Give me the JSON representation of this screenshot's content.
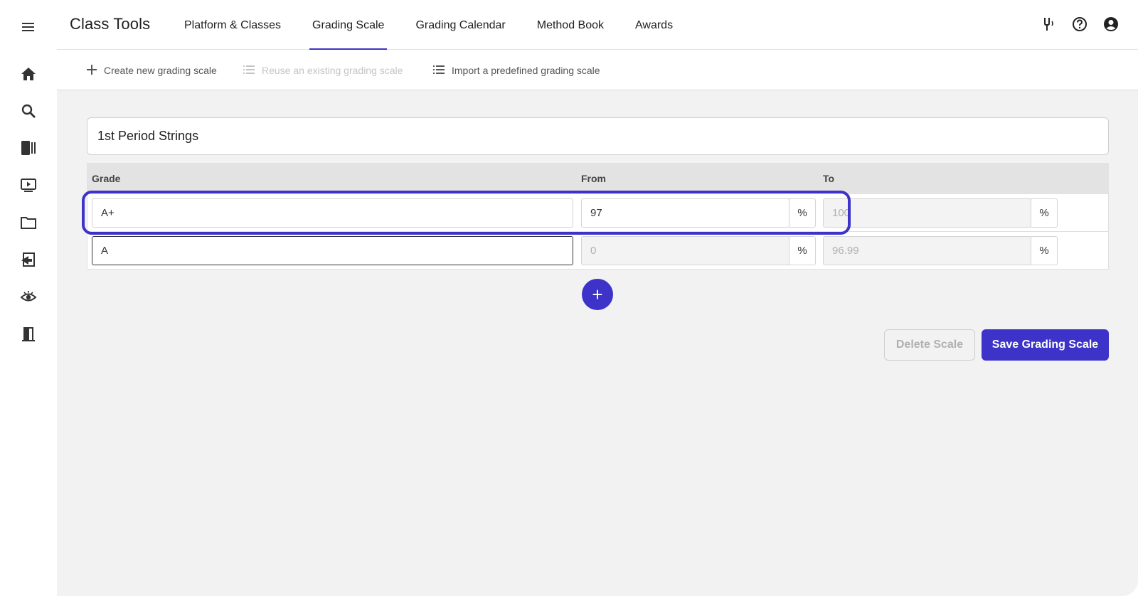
{
  "app": {
    "title": "Class Tools"
  },
  "nav": {
    "tabs": [
      {
        "label": "Platform & Classes"
      },
      {
        "label": "Grading Scale",
        "active": true
      },
      {
        "label": "Grading Calendar"
      },
      {
        "label": "Method Book"
      },
      {
        "label": "Awards"
      }
    ]
  },
  "header_icons": [
    "tuning-fork-icon",
    "help-icon",
    "account-icon"
  ],
  "sidebar": {
    "icons": [
      "menu-icon",
      "home-icon",
      "search-icon",
      "library-icon",
      "video-icon",
      "folder-icon",
      "assignment-icon",
      "visibility-icon",
      "exit-icon"
    ]
  },
  "toolbar": {
    "create_label": "Create new grading scale",
    "reuse_label": "Reuse an existing grading scale",
    "import_label": "Import a predefined grading scale"
  },
  "scale": {
    "name": "1st Period Strings",
    "columns": {
      "grade": "Grade",
      "from": "From",
      "to": "To"
    },
    "percent_symbol": "%",
    "rows": [
      {
        "grade": "A+",
        "from": "97",
        "to": "100"
      },
      {
        "grade": "A",
        "from": "0",
        "to": "96.99"
      }
    ]
  },
  "actions": {
    "add_label": "+",
    "delete_label": "Delete Scale",
    "save_label": "Save Grading Scale"
  },
  "colors": {
    "accent": "#3d33c8",
    "background": "#f2f2f2",
    "header_bg": "#e3e3e3"
  }
}
